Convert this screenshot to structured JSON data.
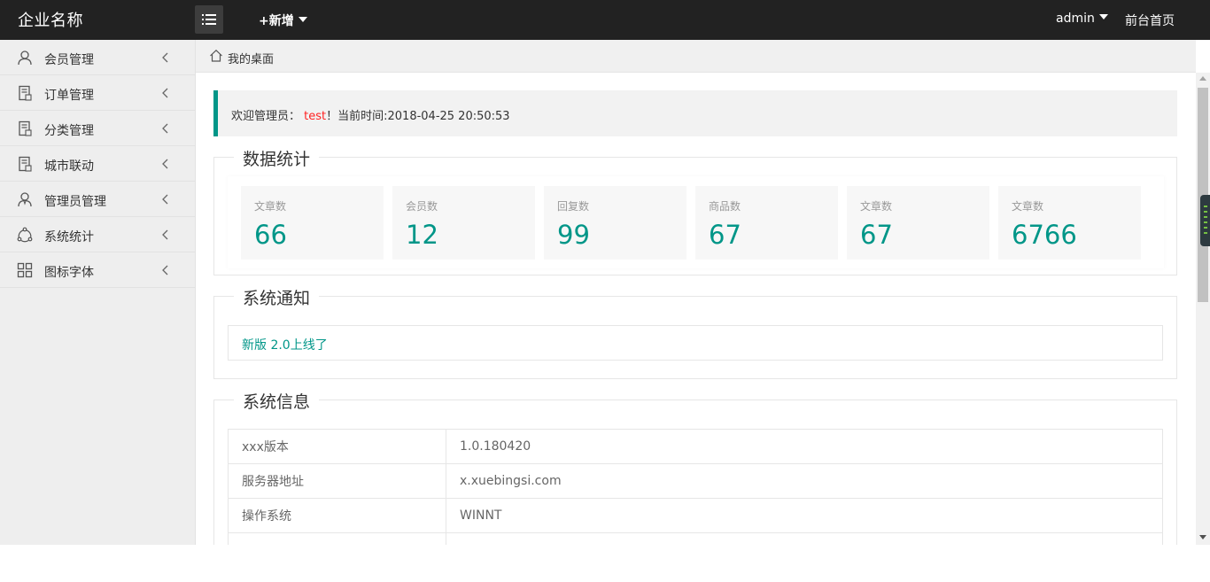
{
  "header": {
    "logo": "企业名称",
    "add_new": "+新增",
    "user": "admin",
    "front_home": "前台首页"
  },
  "sidebar": {
    "items": [
      {
        "label": "会员管理",
        "icon": "user-icon"
      },
      {
        "label": "订单管理",
        "icon": "order-icon"
      },
      {
        "label": "分类管理",
        "icon": "category-icon"
      },
      {
        "label": "城市联动",
        "icon": "city-icon"
      },
      {
        "label": "管理员管理",
        "icon": "admin-icon"
      },
      {
        "label": "系统统计",
        "icon": "stats-icon"
      },
      {
        "label": "图标字体",
        "icon": "grid-icon"
      }
    ]
  },
  "breadcrumb": {
    "label": "我的桌面"
  },
  "welcome": {
    "prefix": "欢迎管理员：",
    "name": "test",
    "suffix": "！当前时间:2018-04-25 20:50:53"
  },
  "stats": {
    "title": "数据统计",
    "cards": [
      {
        "label": "文章数",
        "value": "66"
      },
      {
        "label": "会员数",
        "value": "12"
      },
      {
        "label": "回复数",
        "value": "99"
      },
      {
        "label": "商品数",
        "value": "67"
      },
      {
        "label": "文章数",
        "value": "67"
      },
      {
        "label": "文章数",
        "value": "6766"
      }
    ]
  },
  "notice": {
    "title": "系统通知",
    "text": "新版 2.0上线了"
  },
  "sysinfo": {
    "title": "系统信息",
    "rows": [
      {
        "key": "xxx版本",
        "value": "1.0.180420"
      },
      {
        "key": "服务器地址",
        "value": "x.xuebingsi.com"
      },
      {
        "key": "操作系统",
        "value": "WINNT"
      },
      {
        "key": "",
        "value": ""
      }
    ]
  },
  "colors": {
    "header_bg": "#222222",
    "accent": "#009688",
    "highlight_name": "#ff2222",
    "sidebar_bg": "#eeeeee"
  }
}
